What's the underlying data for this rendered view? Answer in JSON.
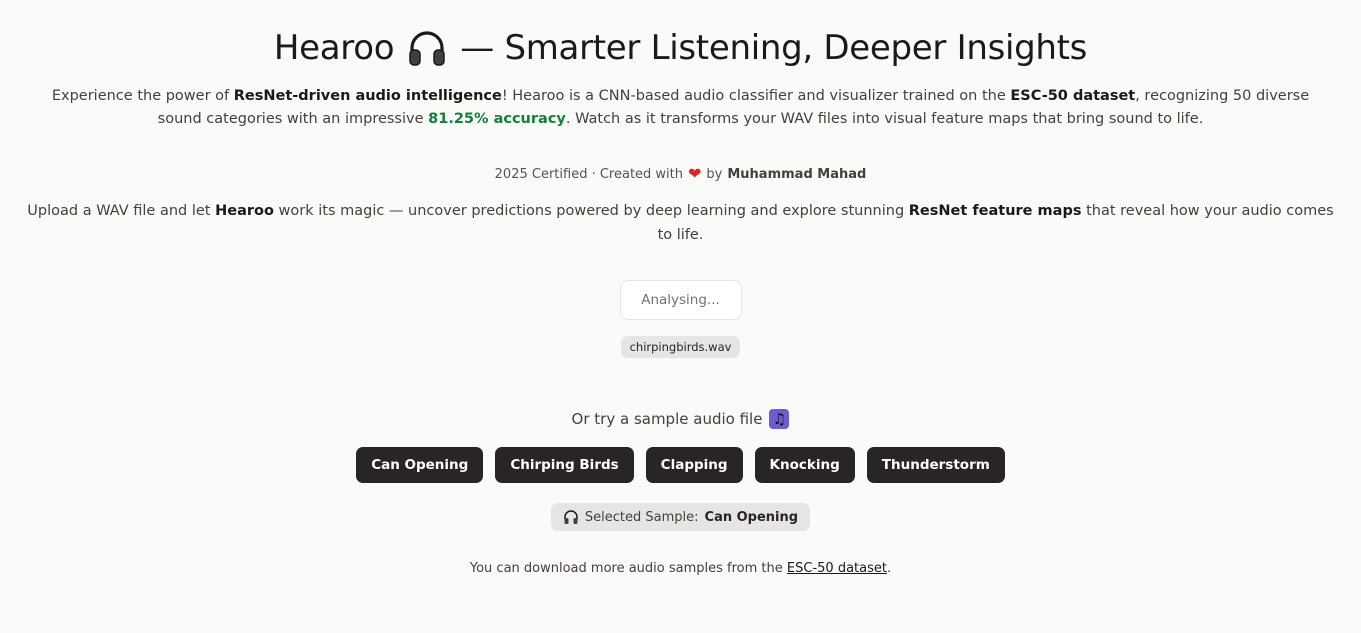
{
  "header": {
    "title_prefix": "Hearoo",
    "title_suffix": "— Smarter Listening, Deeper Insights",
    "title_icon": "headphones-icon"
  },
  "intro": {
    "p1": "Experience the power of ",
    "b1": "ResNet-driven audio intelligence",
    "p2": "! Hearoo is a CNN-based audio classifier and visualizer trained on the ",
    "b2": "ESC-50 dataset",
    "p3": ", recognizing 50 diverse sound categories with an impressive ",
    "accuracy": "81.25% accuracy",
    "p4": ". Watch as it transforms your WAV files into visual feature maps that bring sound to life.",
    "accuracy_color": "#15803d"
  },
  "credit": {
    "prefix": "2025 Certified · Created with",
    "heart_icon": "heart-icon",
    "by": "by",
    "author": "Muhammad Mahad"
  },
  "upload": {
    "p1": "Upload a WAV file and let ",
    "b1": "Hearoo",
    "p2": " work its magic — uncover predictions powered by deep learning and explore stunning ",
    "b2": "ResNet feature maps",
    "p3": " that reveal how your audio comes to life.",
    "button_label": "Analysing...",
    "file_name": "chirpingbirds.wav"
  },
  "samples": {
    "heading": "Or try a sample audio file",
    "heading_icon": "music-note-icon",
    "buttons": [
      "Can Opening",
      "Chirping Birds",
      "Clapping",
      "Knocking",
      "Thunderstorm"
    ],
    "selected_label": "Selected Sample:",
    "selected_value": "Can Opening"
  },
  "footer": {
    "text_before": "You can download more audio samples from the ",
    "link_text": "ESC-50 dataset",
    "text_after": "."
  },
  "colors": {
    "background": "#fafaf9",
    "button_bg": "#292524",
    "chip_bg": "#e7e5e4"
  }
}
